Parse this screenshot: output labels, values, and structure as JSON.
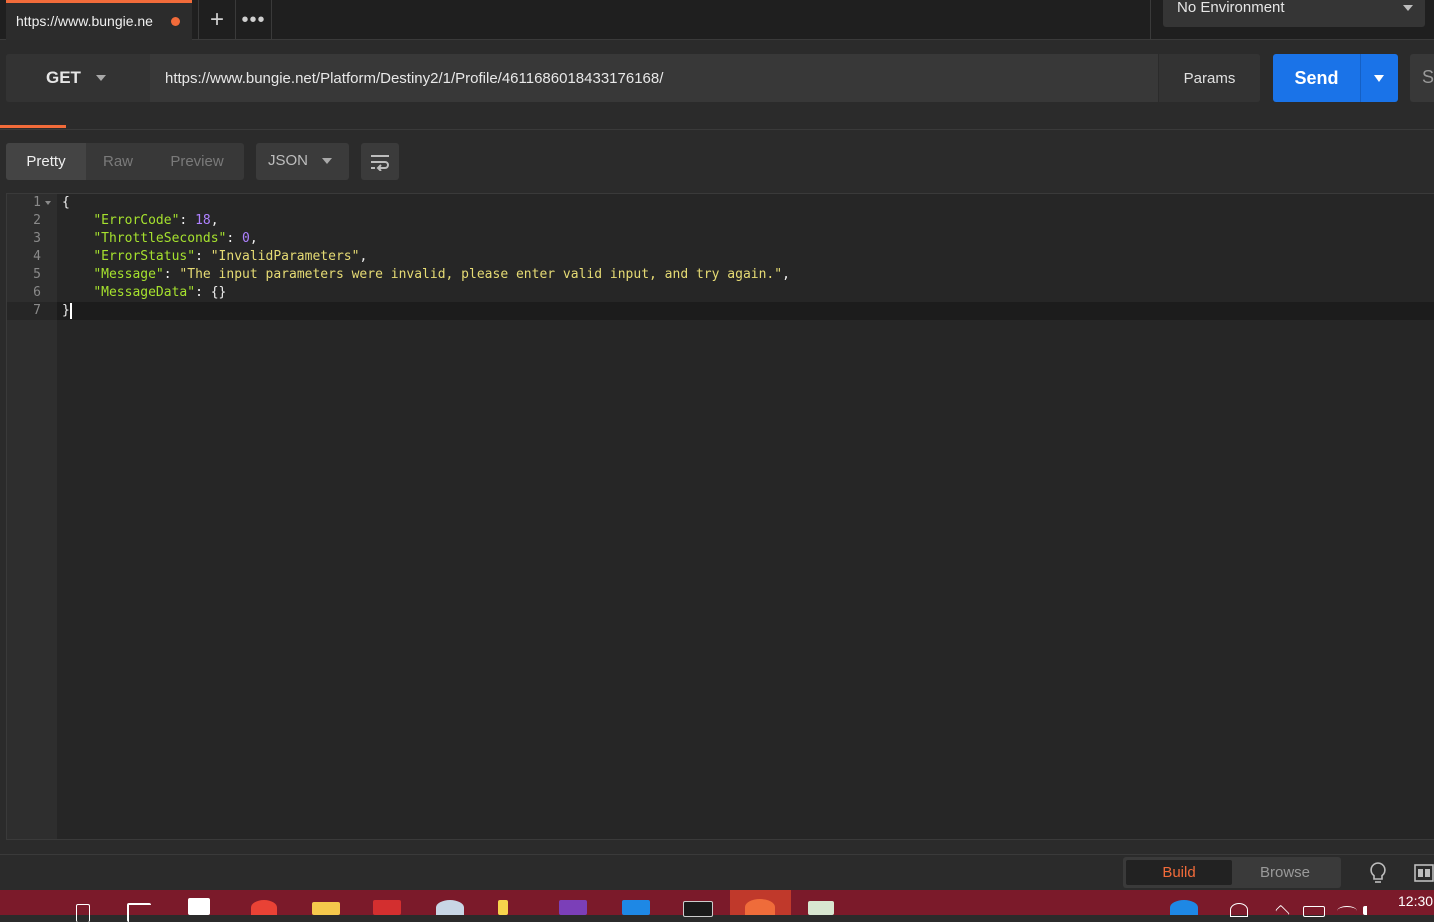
{
  "tabs": {
    "active_tab_label": "https://www.bungie.ne",
    "new_tab_symbol": "+",
    "more_symbol": "•••"
  },
  "environment": {
    "selected": "No Environment"
  },
  "request": {
    "method": "GET",
    "url": "https://www.bungie.net/Platform/Destiny2/1/Profile/4611686018433176168/",
    "params_label": "Params",
    "send_label": "Send",
    "save_label_partial": "Sa"
  },
  "response_toolbar": {
    "view_modes": [
      "Pretty",
      "Raw",
      "Preview"
    ],
    "active_view": "Pretty",
    "format": "JSON"
  },
  "response_body": {
    "line_numbers": [
      "1",
      "2",
      "3",
      "4",
      "5",
      "6",
      "7"
    ],
    "lines": [
      {
        "text": "{"
      },
      {
        "key": "\"ErrorCode\"",
        "value": "18",
        "value_type": "number",
        "comma": ","
      },
      {
        "key": "\"ThrottleSeconds\"",
        "value": "0",
        "value_type": "number",
        "comma": ","
      },
      {
        "key": "\"ErrorStatus\"",
        "value": "\"InvalidParameters\"",
        "value_type": "string",
        "comma": ","
      },
      {
        "key": "\"Message\"",
        "value": "\"The input parameters were invalid, please enter valid input, and try again.\"",
        "value_type": "string",
        "comma": ","
      },
      {
        "key": "\"MessageData\"",
        "value": "{}",
        "value_type": "object",
        "comma": ""
      },
      {
        "text": "}"
      }
    ]
  },
  "footer": {
    "build_label": "Build",
    "browse_label": "Browse",
    "active_mode": "Build",
    "clock": "12:30"
  },
  "colors": {
    "accent": "#f26b3a",
    "send_blue": "#1a73e8",
    "json_key": "#a6e22e",
    "json_number": "#ae81ff",
    "json_string": "#e6db74",
    "taskbar": "#7b1a2a"
  },
  "icons": {
    "tab_dirty": "unsaved-dot-icon",
    "wrap": "wrap-lines-icon",
    "bulb": "lightbulb-icon",
    "layout": "two-pane-layout-icon",
    "taskbar": [
      "search-icon",
      "task-view-icon",
      "store-icon",
      "chrome-icon",
      "file-explorer-icon",
      "filezilla-icon",
      "steam-icon",
      "sticky-notes-icon",
      "visual-studio-icon",
      "vscode-icon",
      "terminal-icon",
      "postman-icon",
      "notepad-icon",
      "help-icon",
      "people-icon",
      "tray-chevron-icon",
      "battery-icon",
      "wifi-icon",
      "volume-icon"
    ]
  }
}
